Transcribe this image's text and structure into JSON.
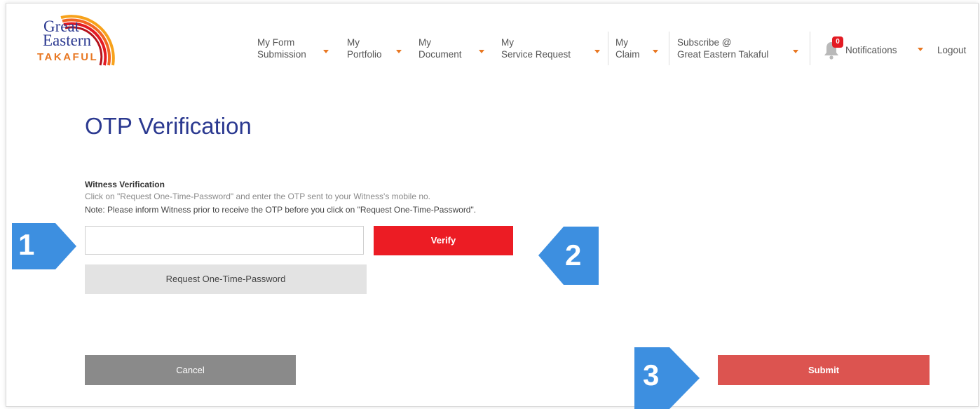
{
  "brand": {
    "line1": "Great",
    "line2": "Eastern",
    "line3": "TAKAFUL"
  },
  "nav": {
    "items": [
      {
        "line1": "My Form",
        "line2": "Submission"
      },
      {
        "line1": "My",
        "line2": "Portfolio"
      },
      {
        "line1": "My",
        "line2": "Document"
      },
      {
        "line1": "My",
        "line2": "Service Request"
      },
      {
        "line1": "My",
        "line2": "Claim"
      },
      {
        "line1": "Subscribe @",
        "line2": "Great Eastern Takaful"
      }
    ],
    "notifications_count": "0",
    "notifications_label": "Notifications",
    "logout_label": "Logout",
    "caret_color": "#e87722"
  },
  "page": {
    "title": "OTP Verification"
  },
  "witness": {
    "section_title": "Witness Verification",
    "instruction": "Click on \"Request One-Time-Password\" and enter the OTP sent to your Witness's mobile no.",
    "note": "Note: Please inform Witness prior to receive the OTP before you click on \"Request One-Time-Password\".",
    "otp_value": "",
    "verify_label": "Verify",
    "request_label": "Request One-Time-Password"
  },
  "actions": {
    "cancel_label": "Cancel",
    "submit_label": "Submit"
  },
  "callouts": [
    "1",
    "2",
    "3"
  ],
  "colors": {
    "brand_blue": "#2b3990",
    "brand_orange": "#e87722",
    "verify_red": "#ec1c24",
    "submit_red": "#dc5450",
    "cancel_gray": "#8a8a8a",
    "callout_blue": "#3d8fe0"
  }
}
